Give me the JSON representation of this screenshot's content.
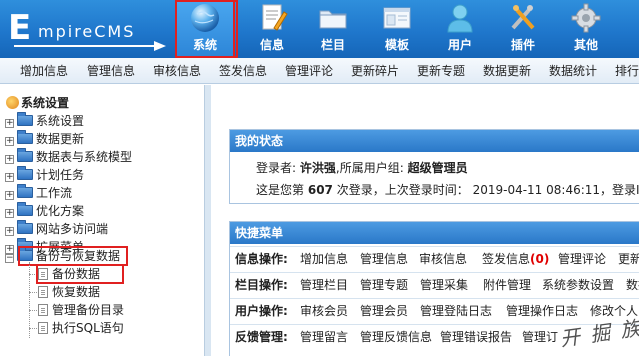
{
  "logo": {
    "initial": "E",
    "rest": "mpireCMS"
  },
  "nav": [
    {
      "label": "系统",
      "icon": "globe-icon",
      "active": true
    },
    {
      "label": "信息",
      "icon": "document-icon"
    },
    {
      "label": "栏目",
      "icon": "folder-icon"
    },
    {
      "label": "模板",
      "icon": "template-icon"
    },
    {
      "label": "用户",
      "icon": "user-icon"
    },
    {
      "label": "插件",
      "icon": "plugin-tools-icon"
    },
    {
      "label": "其他",
      "icon": "gear-icon"
    }
  ],
  "submenu": [
    "增加信息",
    "管理信息",
    "审核信息",
    "签发信息",
    "管理评论",
    "更新碎片",
    "更新专题",
    "数据更新",
    "数据统计",
    "排行"
  ],
  "sidebar": {
    "root": "系统设置",
    "nodes": [
      "系统设置",
      "数据更新",
      "数据表与系统模型",
      "计划任务",
      "工作流",
      "优化方案",
      "网站多访问端",
      "扩展菜单",
      "备份与恢复数据"
    ],
    "expanded_children": [
      "备份数据",
      "恢复数据",
      "管理备份目录",
      "执行SQL语句"
    ]
  },
  "status": {
    "title": "我的状态",
    "login_label": "登录者:",
    "username": "许洪强",
    "group_label": ",所属用户组:",
    "group": "超级管理员",
    "visits_prefix": "这是您第",
    "visits": "607",
    "visits_suffix": "次登录，上次登录时间：",
    "last_login": "2019-04-11 08:46:11",
    "ip_label": "，登录IP:"
  },
  "quick": {
    "title": "快捷菜单",
    "rows": [
      {
        "label": "信息操作:",
        "links": [
          "增加信息",
          "管理信息",
          "审核信息",
          "签发信息",
          "管理评论",
          "更新"
        ],
        "badge": "(0)"
      },
      {
        "label": "栏目操作:",
        "links": [
          "管理栏目",
          "管理专题",
          "管理采集",
          "附件管理",
          "系统参数设置",
          "数据"
        ]
      },
      {
        "label": "用户操作:",
        "links": [
          "审核会员",
          "管理会员",
          "管理登陆日志",
          "管理操作日志",
          "修改个人"
        ]
      },
      {
        "label": "反馈管理:",
        "links": [
          "管理留言",
          "管理反馈信息",
          "管理错误报告",
          "管理订"
        ]
      }
    ]
  },
  "watermark": "开 掘 族",
  "colors": {
    "header": "#1f77cc",
    "highlight": "#e02020",
    "accent_red": "#e00000"
  }
}
